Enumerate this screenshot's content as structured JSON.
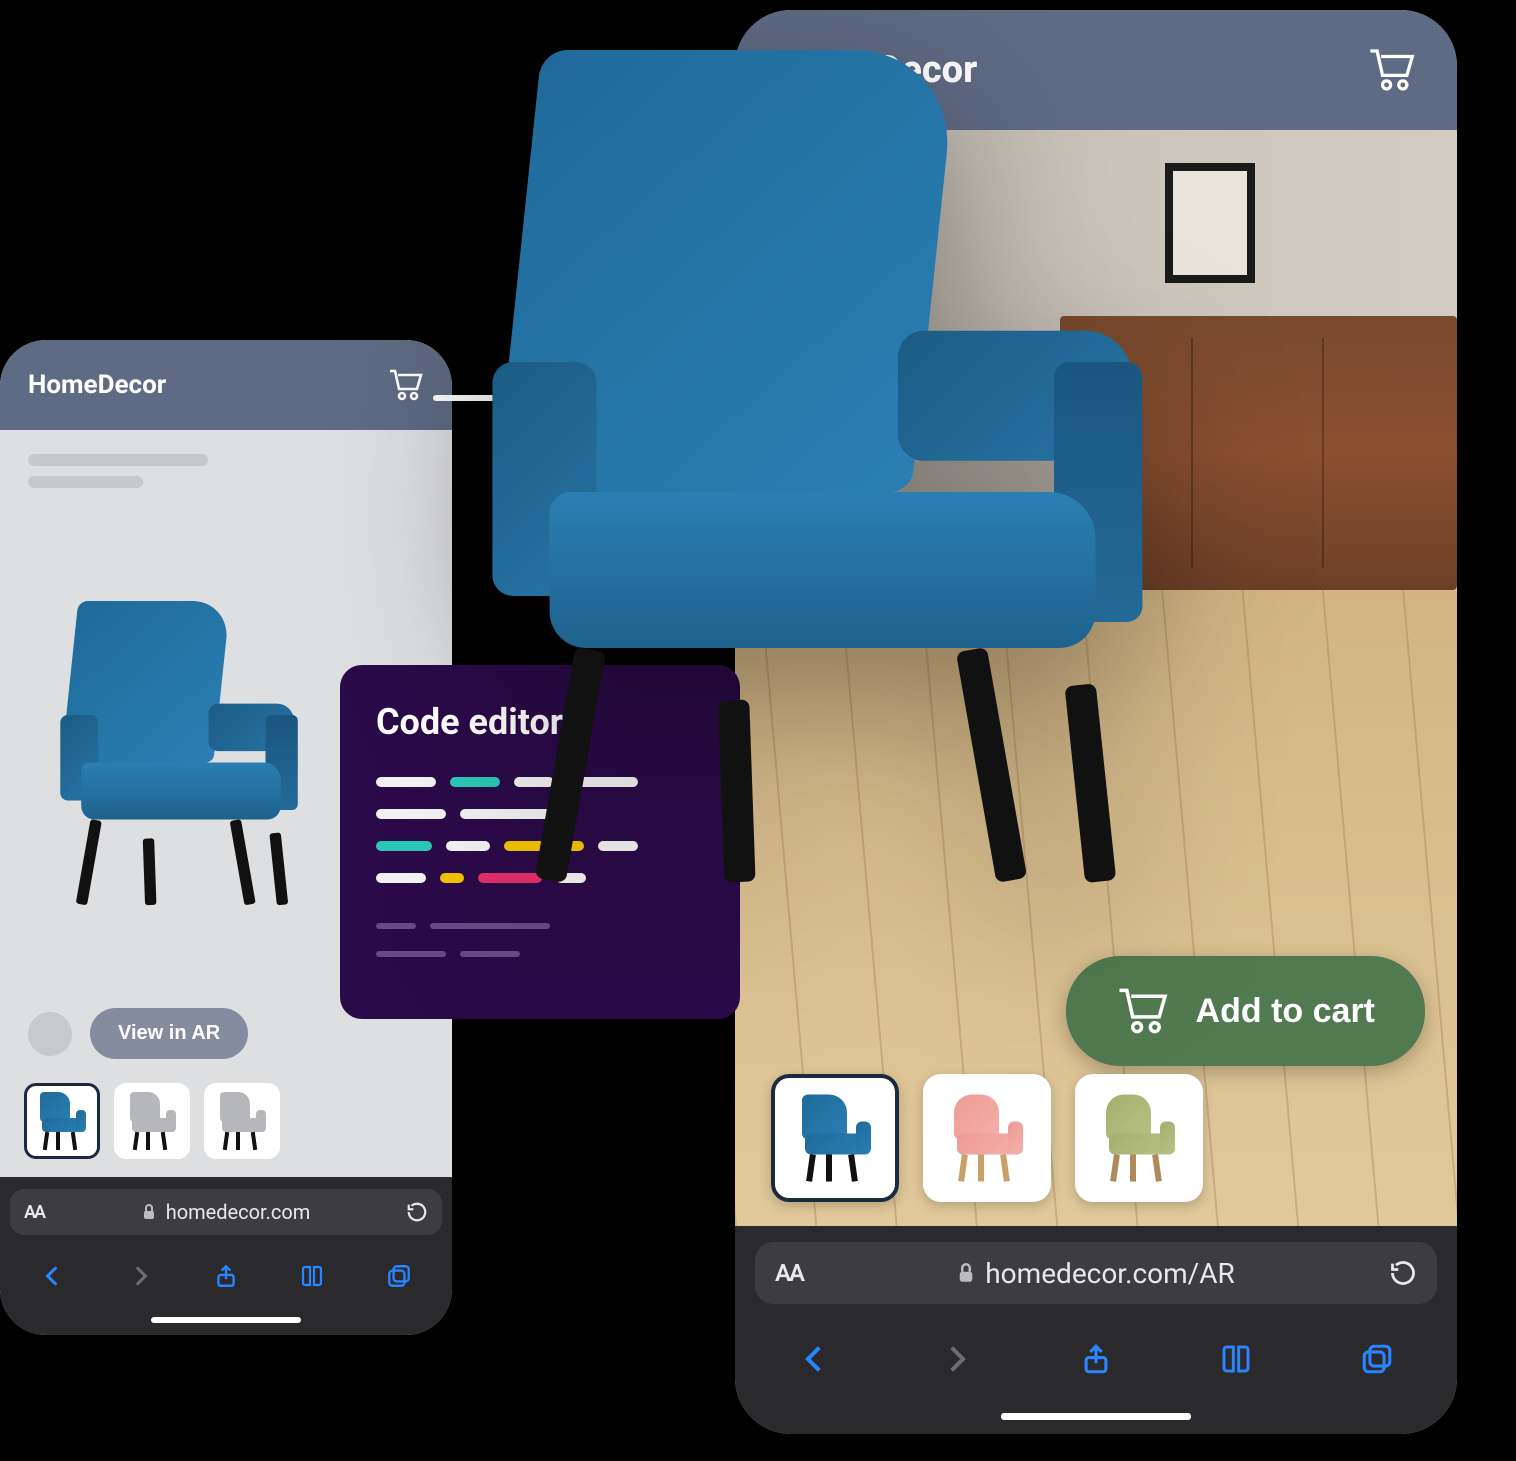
{
  "left_phone": {
    "app_title": "HomeDecor",
    "view_ar_label": "View in AR",
    "url": "homedecor.com",
    "thumbs": [
      "blue-chair",
      "gray-chair",
      "gray-chair"
    ]
  },
  "right_phone": {
    "app_title": "HomeDecor",
    "add_to_cart_label": "Add to cart",
    "url": "homedecor.com/AR",
    "thumbs": [
      "blue-chair",
      "pink-chair",
      "green-chair"
    ]
  },
  "code_panel": {
    "title": "Code editor"
  },
  "browser_toolbar": {
    "back": "back",
    "forward": "forward",
    "share": "share",
    "bookmarks": "bookmarks",
    "tabs": "tabs"
  },
  "colors": {
    "appbar": "#5f6b84",
    "cta_green": "#517a50",
    "code_bg": "#2a0a48"
  }
}
